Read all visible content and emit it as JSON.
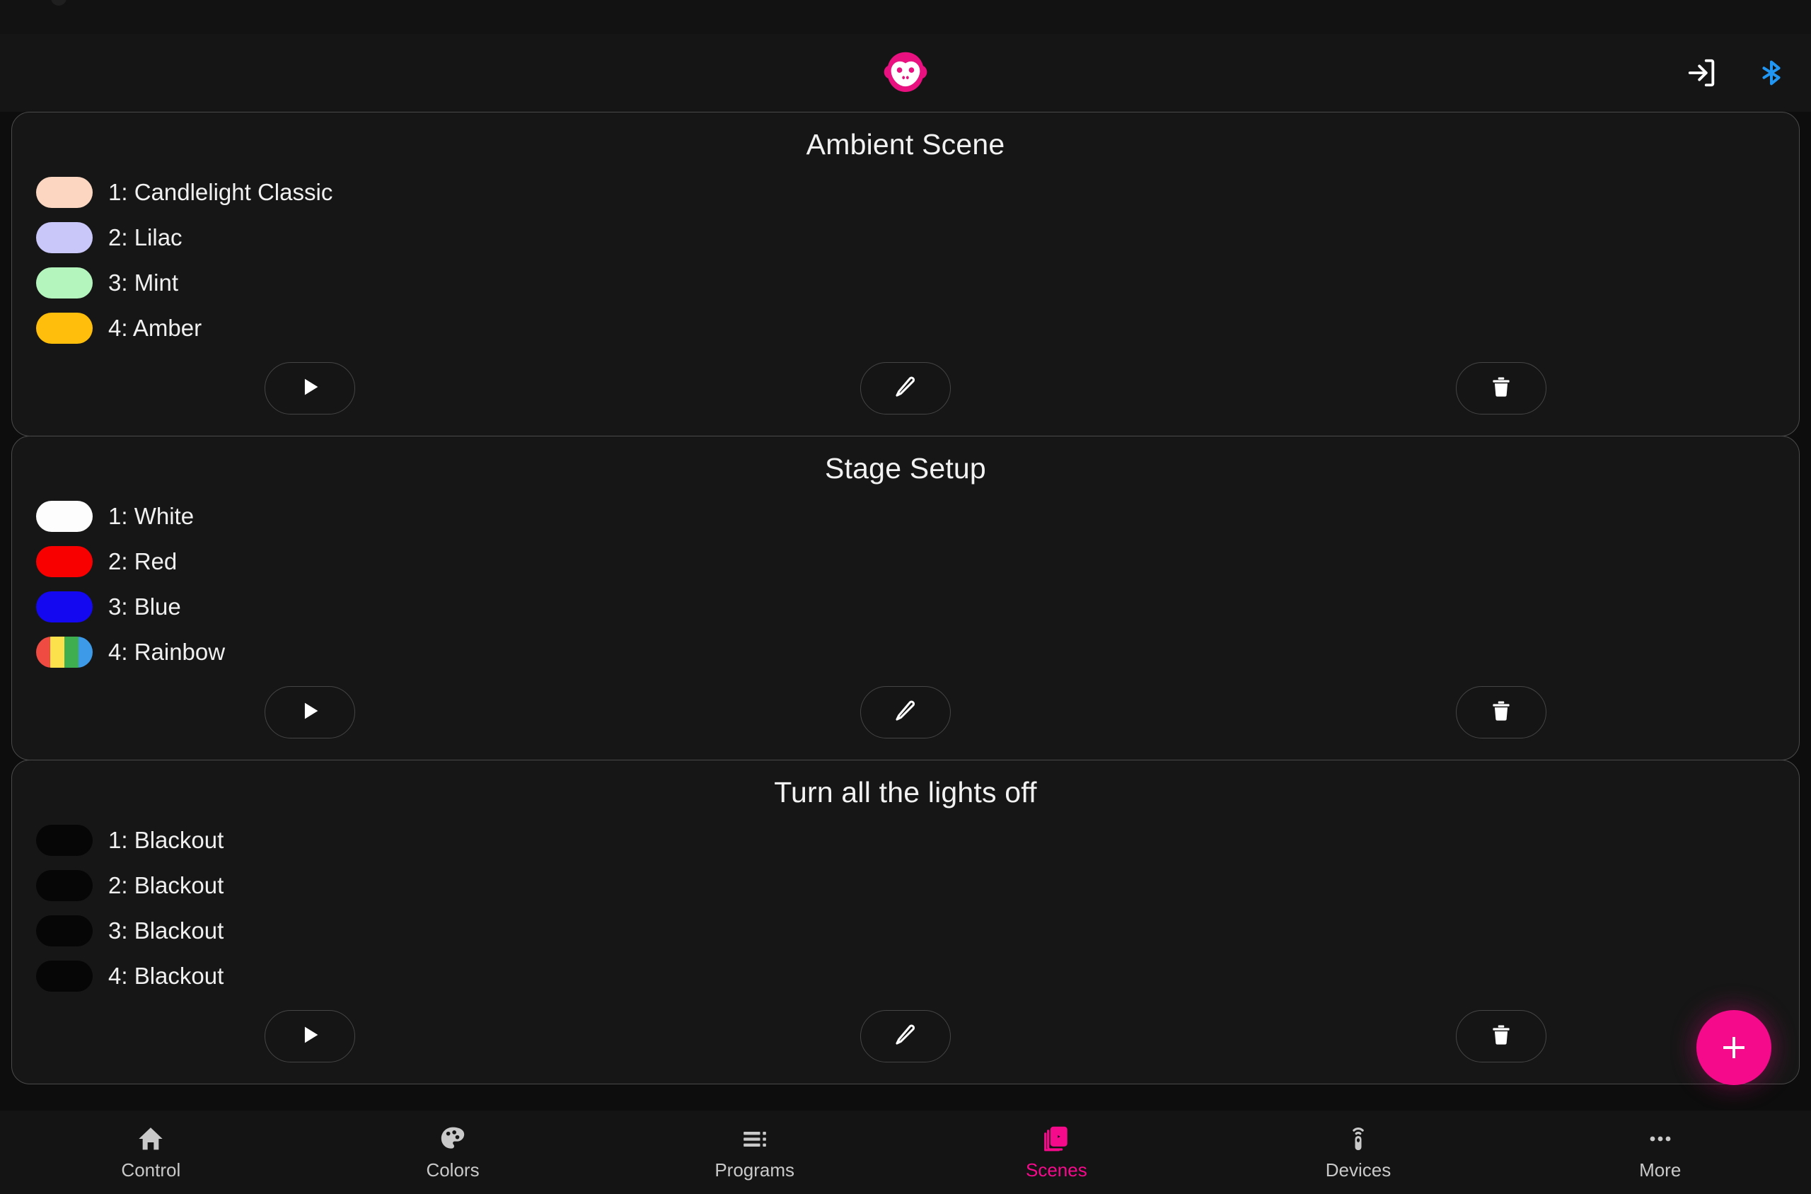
{
  "app": {
    "logo_icon": "monkey-head-logo",
    "accent_color": "#f50a8c",
    "background_color": "#0d0d0d"
  },
  "header": {
    "login_icon": "login-arrow-icon",
    "bluetooth_icon": "bluetooth-icon",
    "bluetooth_color": "#2196f3"
  },
  "scenes": [
    {
      "title": "Ambient Scene",
      "rows": [
        {
          "label": "1: Candlelight Classic",
          "colors": [
            "#fcd6c0"
          ]
        },
        {
          "label": "2: Lilac",
          "colors": [
            "#c9c6f9"
          ]
        },
        {
          "label": "3: Mint",
          "colors": [
            "#b3f5bd"
          ]
        },
        {
          "label": "4: Amber",
          "colors": [
            "#ffbe0b"
          ]
        }
      ],
      "actions": {
        "play": "play-icon",
        "edit": "pencil-icon",
        "delete": "trash-icon"
      }
    },
    {
      "title": "Stage Setup",
      "rows": [
        {
          "label": "1: White",
          "colors": [
            "#fdfdfd"
          ]
        },
        {
          "label": "2: Red",
          "colors": [
            "#f90000"
          ]
        },
        {
          "label": "3: Blue",
          "colors": [
            "#1408f0"
          ]
        },
        {
          "label": "4: Rainbow",
          "colors": [
            "#ef4b43",
            "#fce14c",
            "#3fae4f",
            "#3d9ae8"
          ]
        }
      ],
      "actions": {
        "play": "play-icon",
        "edit": "pencil-icon",
        "delete": "trash-icon"
      }
    },
    {
      "title": "Turn all the lights off",
      "rows": [
        {
          "label": "1: Blackout",
          "colors": [
            "#060606"
          ]
        },
        {
          "label": "2: Blackout",
          "colors": [
            "#060606"
          ]
        },
        {
          "label": "3: Blackout",
          "colors": [
            "#060606"
          ]
        },
        {
          "label": "4: Blackout",
          "colors": [
            "#060606"
          ]
        }
      ],
      "actions": {
        "play": "play-icon",
        "edit": "pencil-icon",
        "delete": "trash-icon"
      }
    }
  ],
  "fab": {
    "label": "+",
    "icon": "plus-icon"
  },
  "bottom_nav": {
    "active": "Scenes",
    "items": [
      {
        "label": "Control",
        "icon": "home-icon"
      },
      {
        "label": "Colors",
        "icon": "palette-icon"
      },
      {
        "label": "Programs",
        "icon": "playlist-icon"
      },
      {
        "label": "Scenes",
        "icon": "scenes-icon"
      },
      {
        "label": "Devices",
        "icon": "remote-control-icon"
      },
      {
        "label": "More",
        "icon": "more-dots-icon"
      }
    ]
  }
}
